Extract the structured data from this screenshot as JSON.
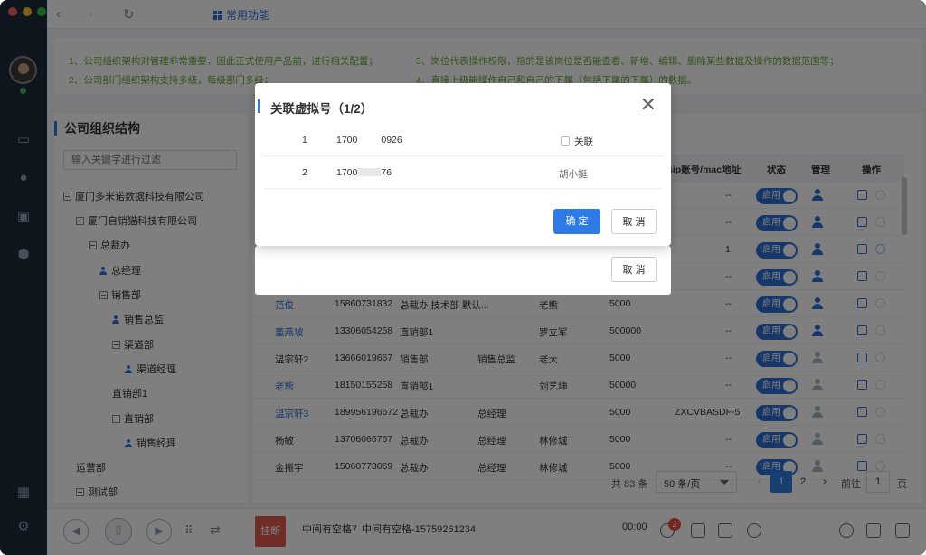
{
  "topbar": {
    "tab_label": "常用功能"
  },
  "notice": {
    "line1": "1、公司组织架构对管理非常重要，因此正式使用产品前，进行相关配置；",
    "line2": "2、公司部门组织架构支持多级，每级部门多级；",
    "line3": "3、岗位代表操作权限，指的是该岗位是否能查看、新增、编辑、删除某些数据及操作的数据范围等；",
    "line4": "4、直接上级能操作自己和自己的下属（包括下属的下属）的数据。"
  },
  "org": {
    "title": "公司组织结构",
    "filter_placeholder": "输入关键字进行过滤",
    "tree": [
      {
        "label": "厦门多米诺数据科技有限公司",
        "type": "folder"
      },
      {
        "label": "厦门自销猫科技有限公司",
        "type": "folder"
      },
      {
        "label": "总裁办",
        "type": "folder"
      },
      {
        "label": "总经理",
        "type": "person"
      },
      {
        "label": "销售部",
        "type": "folder"
      },
      {
        "label": "销售总监",
        "type": "person"
      },
      {
        "label": "渠道部",
        "type": "folder"
      },
      {
        "label": "渠道经理",
        "type": "person"
      },
      {
        "label": "直销部1",
        "type": "text"
      },
      {
        "label": "直销部",
        "type": "folder"
      },
      {
        "label": "销售经理",
        "type": "person"
      },
      {
        "label": "运营部",
        "type": "text"
      },
      {
        "label": "测试部",
        "type": "folder"
      }
    ]
  },
  "table": {
    "headers": {
      "sip": "sip账号/mac地址",
      "status": "状态",
      "manage": "管理",
      "ops": "操作"
    },
    "toggle_label": "启用",
    "rows": [
      {
        "name": "",
        "phone": "",
        "dept": "",
        "post": "",
        "leader": "",
        "limit": "",
        "sip": "--",
        "manage_active": true,
        "op_active": false
      },
      {
        "name": "",
        "phone": "",
        "dept": "",
        "post": "",
        "leader": "",
        "limit": "",
        "sip": "--",
        "manage_active": true,
        "op_active": false
      },
      {
        "name": "",
        "phone": "",
        "dept": "",
        "post": "",
        "leader": "",
        "limit": "",
        "sip": "1",
        "manage_active": true,
        "op_active": true
      },
      {
        "name": "",
        "phone": "",
        "dept": "",
        "post": "",
        "leader": "",
        "limit": "",
        "sip": "--",
        "manage_active": true,
        "op_active": false
      },
      {
        "name": "范俊",
        "phone": "15860731832",
        "dept": "总裁办 技术部 默认...",
        "post": "",
        "leader": "老熊",
        "limit": "5000",
        "sip": "--",
        "manage_active": true,
        "op_active": false
      },
      {
        "name": "董燕坡",
        "phone": "13306054258",
        "dept": "直销部1",
        "post": "",
        "leader": "罗立军",
        "limit": "500000",
        "sip": "--",
        "manage_active": true,
        "op_active": false
      },
      {
        "name": "温宗轩2",
        "phone": "13666019667",
        "dept": "销售部",
        "post": "销售总监",
        "leader": "老大",
        "limit": "5000",
        "sip": "--",
        "manage_active": false,
        "op_active": false
      },
      {
        "name": "老熊",
        "phone": "18150155258",
        "dept": "直销部1",
        "post": "",
        "leader": "刘艺坤",
        "limit": "50000",
        "sip": "--",
        "manage_active": false,
        "op_active": false
      },
      {
        "name": "温宗轩3",
        "phone": "189956196672",
        "dept": "总裁办",
        "post": "总经理",
        "leader": "",
        "limit": "5000",
        "sip": "ZXCVBASDF-5",
        "manage_active": false,
        "op_active": false
      },
      {
        "name": "杨敏",
        "phone": "13706066767",
        "dept": "总裁办",
        "post": "总经理",
        "leader": "林修城",
        "limit": "5000",
        "sip": "--",
        "manage_active": false,
        "op_active": false
      },
      {
        "name": "金振宇",
        "phone": "15060773069",
        "dept": "总裁办",
        "post": "总经理",
        "leader": "林修城",
        "limit": "5000",
        "sip": "--",
        "manage_active": false,
        "op_active": false
      }
    ]
  },
  "pager": {
    "total": "共 83 条",
    "size": "50 条/页",
    "page1": "1",
    "page2": "2",
    "goto": "前往",
    "goto_value": "1",
    "page_suffix": "页"
  },
  "bottom": {
    "hangup": "挂断",
    "caller1": "中间有空格7",
    "caller2": "中间有空格-15759261234",
    "timer": "00:00",
    "badge": "2"
  },
  "back_dialog": {
    "cancel": "取 消"
  },
  "modal": {
    "title": "关联虚拟号（1/2）",
    "rows": [
      {
        "index": "1",
        "number_start": "1700",
        "number_end": "0926",
        "associate_label": "关联"
      },
      {
        "index": "2",
        "number_start": "1700",
        "number_end": "76",
        "assignee": "胡小挺"
      }
    ],
    "confirm": "确 定",
    "cancel": "取 消"
  },
  "colors": {
    "accent": "#2f7be6",
    "sidebar": "#1d2a3a",
    "notice_green": "#6aa63a",
    "danger": "#e05a4c"
  }
}
